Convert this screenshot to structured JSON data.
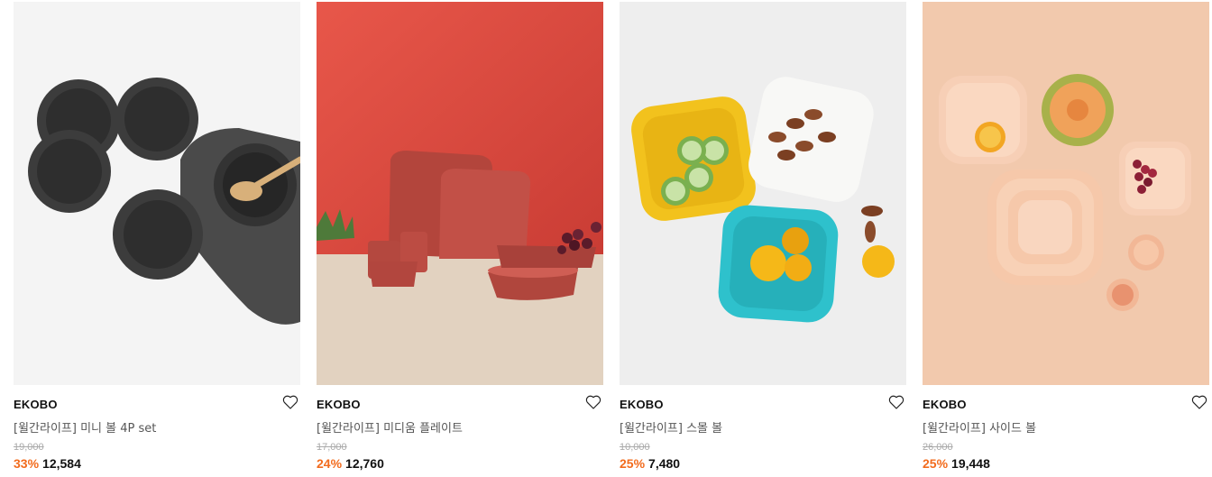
{
  "products": [
    {
      "brand": "EKOBO",
      "title": "[윌간라이프] 미니 볼 4P set",
      "original_price": "19,000",
      "discount": "33%",
      "price": "12,584",
      "image": "black-bowls-photo",
      "wishlist_icon": "heart-outline-icon"
    },
    {
      "brand": "EKOBO",
      "title": "[윌간라이프] 미디움 플레이트",
      "original_price": "17,000",
      "discount": "24%",
      "price": "12,760",
      "image": "red-plates-photo",
      "wishlist_icon": "heart-outline-icon"
    },
    {
      "brand": "EKOBO",
      "title": "[윌간라이프] 스몰 볼",
      "original_price": "10,000",
      "discount": "25%",
      "price": "7,480",
      "image": "colorful-bowls-photo",
      "wishlist_icon": "heart-outline-icon"
    },
    {
      "brand": "EKOBO",
      "title": "[윌간라이프] 사이드 볼",
      "original_price": "26,000",
      "discount": "25%",
      "price": "19,448",
      "image": "peach-plates-photo",
      "wishlist_icon": "heart-outline-icon"
    }
  ],
  "colors": {
    "discount": "#f26b1d",
    "strike": "#aaaaaa",
    "brand": "#111111"
  }
}
